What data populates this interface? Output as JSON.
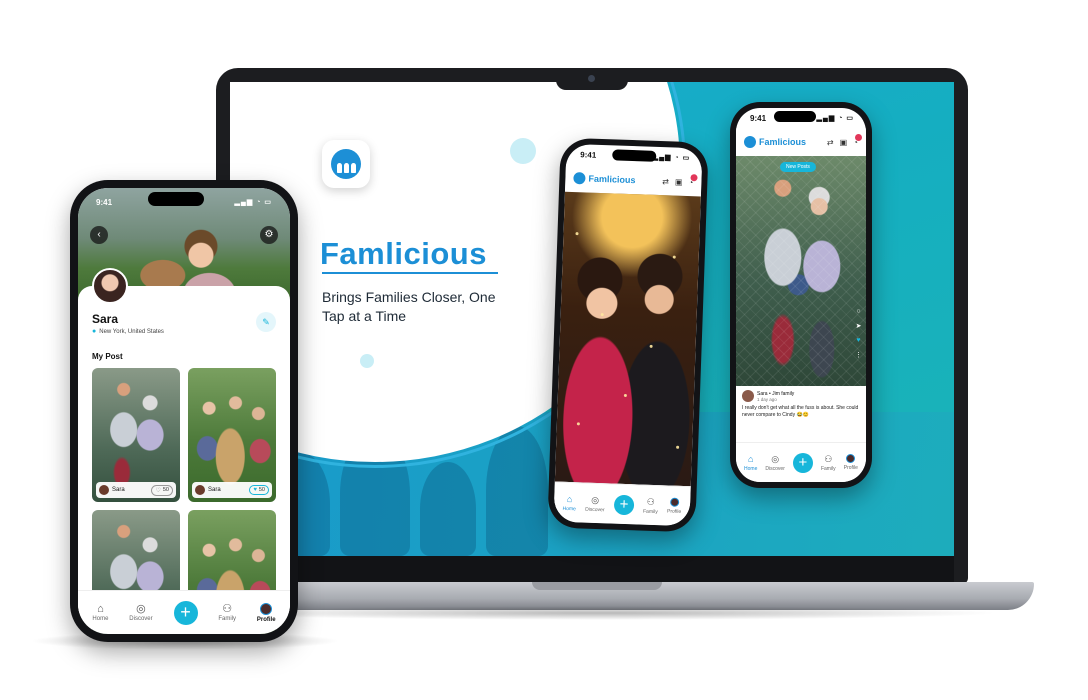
{
  "brand": {
    "name": "Famlicious",
    "tagline": "Brings Families Closer, One Tap at a Time",
    "accent_color": "#1c8fd6",
    "teal_color": "#17b6da"
  },
  "status_bar": {
    "time": "9:41"
  },
  "app_header": {
    "logo_text": "Famlicious"
  },
  "nav": {
    "items": [
      {
        "label": "Home",
        "icon": "home-icon"
      },
      {
        "label": "Discover",
        "icon": "compass-icon"
      },
      {
        "label": "",
        "icon": "plus-icon"
      },
      {
        "label": "Family",
        "icon": "family-icon"
      },
      {
        "label": "Profile",
        "icon": "avatar"
      }
    ]
  },
  "feed_post": {
    "new_posts_label": "New Posts",
    "author": "Sara • Jim family",
    "time_ago": "1 day ago",
    "caption": "I really don't get what all the fuss is about. She could never compare to Cindy 😂😊"
  },
  "profile": {
    "name": "Sara",
    "location": "New York, United States",
    "section_title": "My Post",
    "posts": [
      {
        "author": "Sara",
        "likes": "50",
        "liked": false,
        "kind": "basketball"
      },
      {
        "author": "Sara",
        "likes": "50",
        "liked": true,
        "kind": "dog"
      },
      {
        "author": "",
        "likes": "",
        "liked": false,
        "kind": "basketball"
      },
      {
        "author": "",
        "likes": "",
        "liked": false,
        "kind": "dog"
      }
    ]
  }
}
